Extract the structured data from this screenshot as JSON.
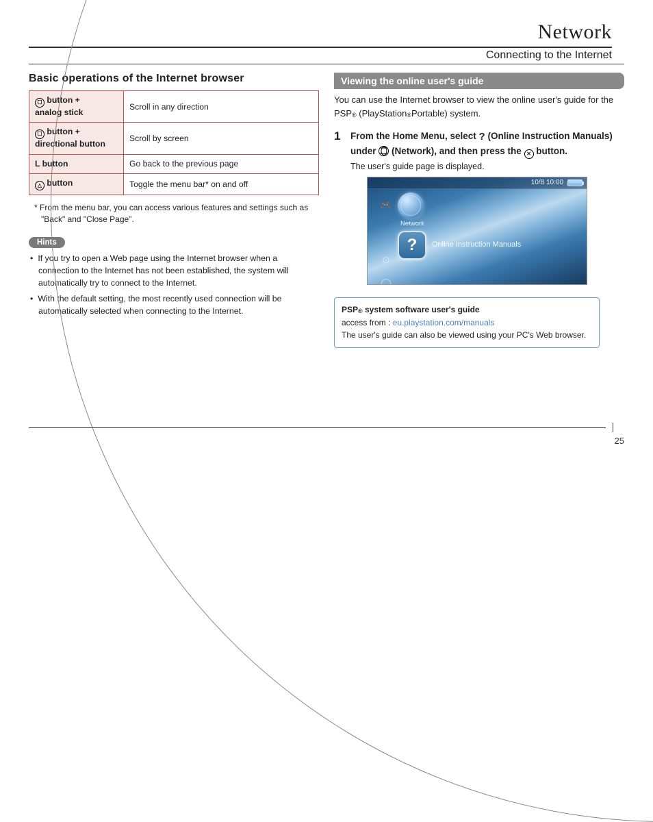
{
  "header": {
    "section": "Network",
    "subsection": "Connecting to the Internet"
  },
  "left": {
    "heading": "Basic operations of the Internet browser",
    "table": [
      {
        "k": " button +\nanalog stick",
        "v": "Scroll in any direction"
      },
      {
        "k": " button +\ndirectional button",
        "v": "Scroll by screen"
      },
      {
        "k": "L button",
        "v": "Go back to the previous page"
      },
      {
        "k": " button",
        "v": "Toggle the menu bar* on and off"
      }
    ],
    "footnote": "*  From the menu bar, you can access various features and settings such as \"Back\" and \"Close Page\".",
    "hints_label": "Hints",
    "hints": [
      "If you try to open a Web page using the Internet browser when a connection to the Internet has not been established, the system will automatically try to connect to the Internet.",
      "With the default setting, the most recently used connection will be automatically selected when connecting to the Internet."
    ]
  },
  "right": {
    "band": "Viewing the online user's guide",
    "intro_a": "You can use the Internet browser to view the online user's guide for the PSP",
    "intro_b": " (PlayStation",
    "intro_c": "Portable) system.",
    "step_num": "1",
    "step_parts": {
      "a": "From the Home Menu, select ",
      "b": "(Online Instruction Manuals) under ",
      "c": " (Network), and then press the ",
      "d": " button."
    },
    "step_note": "The user's guide page is displayed.",
    "shot": {
      "clock": "10/8 10:00",
      "network_label": "Network",
      "selected_label": "Online Instruction Manuals"
    },
    "linkbox": {
      "title_a": "PSP",
      "title_b": " system software user's guide",
      "access": "access from : ",
      "url": "eu.playstation.com/manuals",
      "note": "The user's guide can also be viewed using your PC's Web browser."
    }
  },
  "page_number": "25"
}
